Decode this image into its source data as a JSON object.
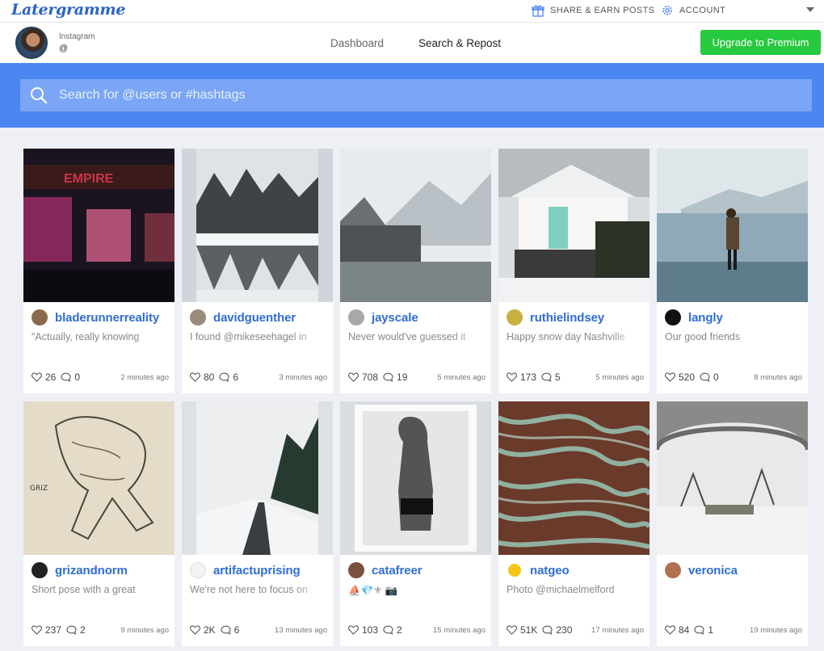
{
  "brand": {
    "logo": "Latergramme"
  },
  "topbar": {
    "share": "SHARE & EARN POSTS",
    "account": "ACCOUNT"
  },
  "header": {
    "ig_label": "Instagram",
    "ig_handle": "@",
    "nav": [
      "Dashboard",
      "Search & Repost"
    ],
    "upgrade": "Upgrade to Premium"
  },
  "search": {
    "placeholder": "Search for @users or #hashtags"
  },
  "colors": {
    "accent": "#4c86f0",
    "link": "#2f6dd6",
    "premium": "#27c93f"
  },
  "posts": [
    {
      "username": "bladerunnerreality",
      "caption": "\"Actually, really knowing",
      "likes": "26",
      "comments": "0",
      "time": "2 minutes ago"
    },
    {
      "username": "davidguenther",
      "caption": "I found @mikeseehagel in",
      "likes": "80",
      "comments": "6",
      "time": "3 minutes ago"
    },
    {
      "username": "jayscale",
      "caption": "Never would've guessed it",
      "likes": "708",
      "comments": "19",
      "time": "5 minutes ago"
    },
    {
      "username": "ruthielindsey",
      "caption": "Happy snow day Nashville",
      "likes": "173",
      "comments": "5",
      "time": "5 minutes ago"
    },
    {
      "username": "langly",
      "caption": "Our good friends",
      "likes": "520",
      "comments": "0",
      "time": "8 minutes ago"
    },
    {
      "username": "grizandnorm",
      "caption": "Short pose with a great",
      "likes": "237",
      "comments": "2",
      "time": "9 minutes ago"
    },
    {
      "username": "artifactuprising",
      "caption": "We're not here to focus on",
      "likes": "2K",
      "comments": "6",
      "time": "13 minutes ago"
    },
    {
      "username": "catafreer",
      "caption": "⛵💎⚜ 📷",
      "likes": "103",
      "comments": "2",
      "time": "15 minutes ago"
    },
    {
      "username": "natgeo",
      "caption": "Photo @michaelmelford",
      "likes": "51K",
      "comments": "230",
      "time": "17 minutes ago"
    },
    {
      "username": "veronica",
      "caption": "",
      "likes": "84",
      "comments": "1",
      "time": "19 minutes ago"
    }
  ]
}
